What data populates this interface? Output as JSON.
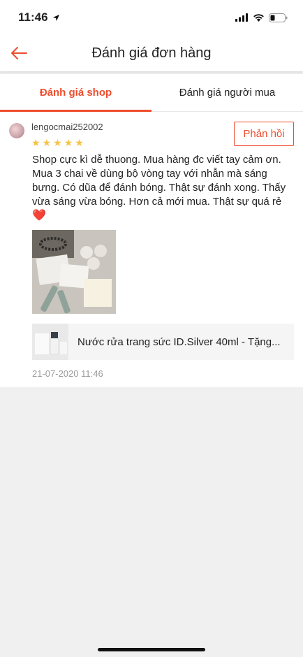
{
  "status_bar": {
    "time": "11:46"
  },
  "header": {
    "title": "Đánh giá đơn hàng"
  },
  "tabs": [
    {
      "label": "Đánh giá shop",
      "active": true
    },
    {
      "label": "Đánh giá người mua",
      "active": false
    }
  ],
  "review": {
    "username": "lengocmai252002",
    "rating": 5,
    "reply_label": "Phản hồi",
    "comment": "Shop cực kì dễ thuong. Mua hàng đc viết tay cảm ơn. Mua 3 chai về dùng bộ vòng tay với nhẫn mà sáng bưng. Có dũa để đánh bóng. Thật sự đánh xong. Thấy vừa sáng vừa bóng. Hơn cả mới mua. Thật sự quá rẻ",
    "heart": "❤️",
    "product_name": "Nước rửa trang sức ID.Silver 40ml - Tặng...",
    "date": "21-07-2020 11:46"
  },
  "colors": {
    "accent": "#ee4d2d",
    "star": "#f6c344"
  }
}
